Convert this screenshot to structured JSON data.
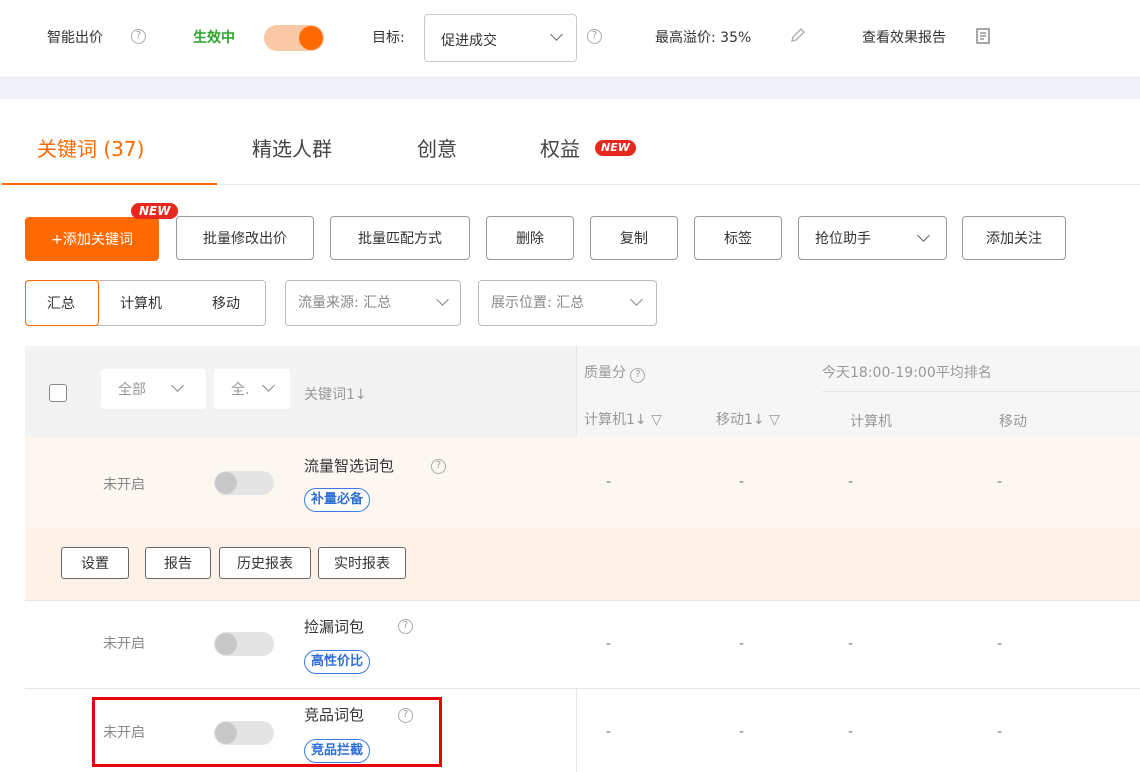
{
  "topbar": {
    "smart_bid_label": "智能出价",
    "status_text": "生效中",
    "target_label": "目标:",
    "target_value": "促进成交",
    "max_premium_label": "最高溢价: 35%",
    "report_link": "查看效果报告"
  },
  "tabs": [
    {
      "label": "关键词 (37)",
      "active": true
    },
    {
      "label": "精选人群"
    },
    {
      "label": "创意"
    },
    {
      "label": "权益"
    }
  ],
  "new_badge": "NEW",
  "toolbar": {
    "add_keyword": "+添加关键词",
    "batch_bid": "批量修改出价",
    "batch_match": "批量匹配方式",
    "delete": "删除",
    "copy": "复制",
    "tag": "标签",
    "rank_helper": "抢位助手",
    "add_follow": "添加关注"
  },
  "segments": {
    "summary": "汇总",
    "computer": "计算机",
    "mobile": "移动"
  },
  "filters": {
    "traffic_source": "流量来源: 汇总",
    "display_position": "展示位置: 汇总"
  },
  "table": {
    "header": {
      "all_select": "全部",
      "all_short": "全.",
      "keyword_col": "关键词",
      "quality_score": "质量分",
      "avg_rank": "今天18:00-19:00平均排名",
      "computer": "计算机",
      "mobile": "移动"
    },
    "rows": [
      {
        "status": "未开启",
        "name": "流量智选词包",
        "tag": "补量必备",
        "values": [
          "-",
          "-",
          "-",
          "-"
        ]
      },
      {
        "status": "未开启",
        "name": "捡漏词包",
        "tag": "高性价比",
        "values": [
          "-",
          "-",
          "-",
          "-"
        ]
      },
      {
        "status": "未开启",
        "name": "竞品词包",
        "tag": "竞品拦截",
        "values": [
          "-",
          "-",
          "-",
          "-"
        ]
      }
    ],
    "actions": [
      "设置",
      "报告",
      "历史报表",
      "实时报表"
    ]
  }
}
